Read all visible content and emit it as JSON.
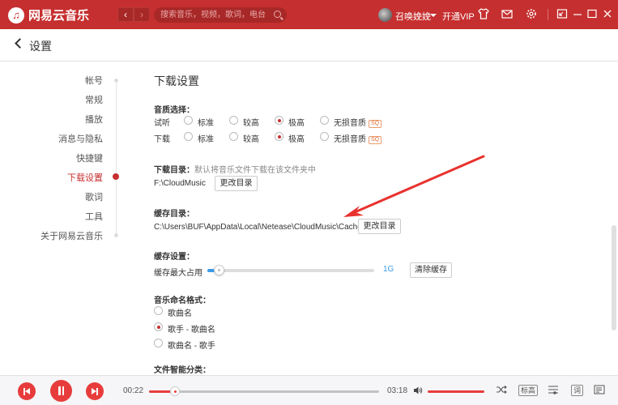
{
  "app": {
    "name": "网易云音乐",
    "search_placeholder": "搜索音乐，视频，歌词，电台",
    "username": "召唤娩娩",
    "vip_label": "开通VIP"
  },
  "page": {
    "title": "设置"
  },
  "nav": {
    "items": [
      {
        "label": "帐号"
      },
      {
        "label": "常规"
      },
      {
        "label": "播放"
      },
      {
        "label": "消息与隐私"
      },
      {
        "label": "快捷键"
      },
      {
        "label": "下载设置",
        "active": true
      },
      {
        "label": "歌词"
      },
      {
        "label": "工具"
      },
      {
        "label": "关于网易云音乐"
      }
    ]
  },
  "download": {
    "title": "下载设置",
    "quality_label": "音质选择：",
    "rows": [
      {
        "label": "试听"
      },
      {
        "label": "下载"
      }
    ],
    "options": [
      "标准",
      "较高",
      "极高",
      "无损音质"
    ],
    "sq_badge": "SQ",
    "selected_index": 2,
    "dir_label": "下载目录：",
    "dir_hint": "默认将音乐文件下载在该文件夹中",
    "dir_path": "F:\\CloudMusic",
    "change_dir_button": "更改目录",
    "cache_dir_label": "缓存目录：",
    "cache_dir_path": "C:\\Users\\BUF\\AppData\\Local\\Netease\\CloudMusic\\Cache",
    "cache_change_button": "更改目录",
    "cache_settings_label": "缓存设置：",
    "cache_max_label": "缓存最大占用",
    "cache_max_value": "1G",
    "cache_slider_fraction": 0.08,
    "clear_cache_button": "清除缓存",
    "naming_label": "音乐命名格式：",
    "naming_options": [
      "歌曲名",
      "歌手 - 歌曲名",
      "歌曲名 - 歌手"
    ],
    "naming_selected": 1,
    "smart_label": "文件智能分类："
  },
  "player": {
    "current_time": "00:22",
    "total_time": "03:18",
    "progress_fraction": 0.11,
    "volume_fraction": 1.0,
    "quality_tag": "标高",
    "lyrics_tag": "词"
  },
  "colors": {
    "brand": "#c62f2f",
    "accent_red": "#e83c3c",
    "slider_blue": "#3d9be9"
  }
}
